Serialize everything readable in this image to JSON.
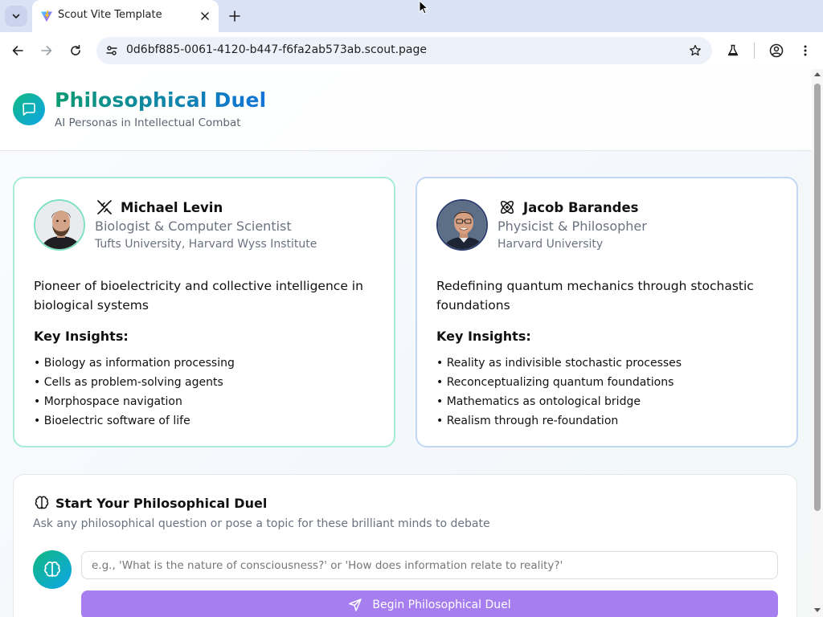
{
  "browser": {
    "tab_title": "Scout Vite Template",
    "url": "0d6bf885-0061-4120-b447-f6fa2ab573ab.scout.page"
  },
  "header": {
    "title": "Philosophical Duel",
    "subtitle": "AI Personas in Intellectual Combat"
  },
  "personas": [
    {
      "name": "Michael Levin",
      "icon": "dna-icon",
      "role": "Biologist & Computer Scientist",
      "institution": "Tufts University, Harvard Wyss Institute",
      "description": "Pioneer of bioelectricity and collective intelligence in biological systems",
      "insights_heading": "Key Insights:",
      "insights": [
        "• Biology as information processing",
        "• Cells as problem-solving agents",
        "• Morphospace navigation",
        "• Bioelectric software of life"
      ],
      "accent": "#a7ecd6"
    },
    {
      "name": "Jacob Barandes",
      "icon": "atom-icon",
      "role": "Physicist & Philosopher",
      "institution": "Harvard University",
      "description": "Redefining quantum mechanics through stochastic foundations",
      "insights_heading": "Key Insights:",
      "insights": [
        "• Reality as indivisible stochastic processes",
        "• Reconceptualizing quantum foundations",
        "• Mathematics as ontological bridge",
        "• Realism through re-foundation"
      ],
      "accent": "#c2d7f4"
    }
  ],
  "duel": {
    "title": "Start Your Philosophical Duel",
    "subtitle": "Ask any philosophical question or pose a topic for these brilliant minds to debate",
    "input_placeholder": "e.g., 'What is the nature of consciousness?' or 'How does information relate to reality?'",
    "input_value": "",
    "button_label": "Begin Philosophical Duel",
    "button_color": "#a67ef0"
  }
}
